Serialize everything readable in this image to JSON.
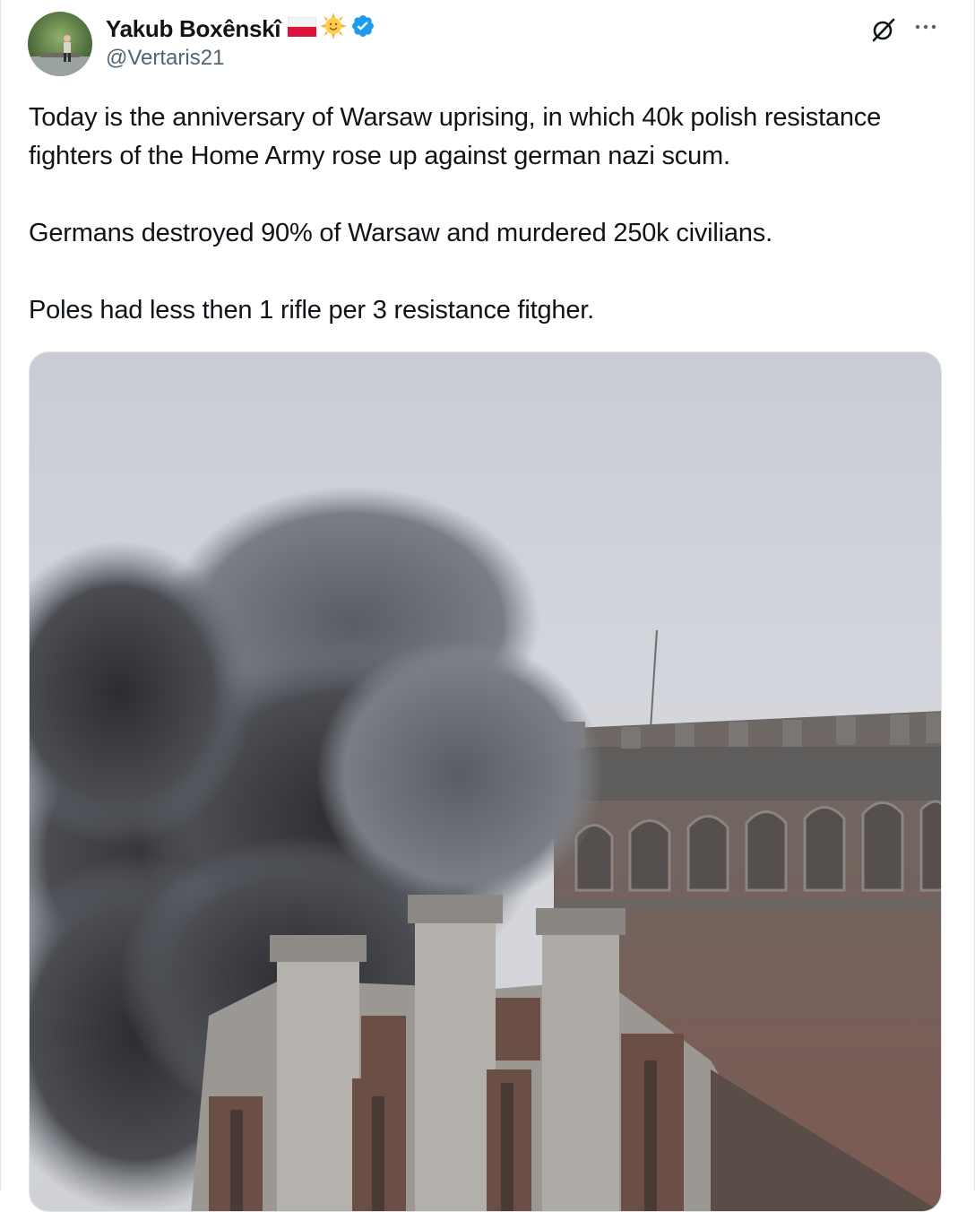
{
  "author": {
    "display_name": "Yakub Boxênskî",
    "handle": "@Vertaris21",
    "badges": [
      "poland-flag-icon",
      "sun-face-icon",
      "verified-badge-icon"
    ]
  },
  "header_actions": [
    "grok-icon",
    "more-icon"
  ],
  "tweet": {
    "paragraphs": [
      "Today is the anniversary of Warsaw uprising, in which 40k polish resistance fighters of the Home Army rose up against german nazi scum.",
      "Germans destroyed 90% of Warsaw and murdered 250k civilians.",
      "Poles had less then 1 rifle per 3 resistance fitgher."
    ]
  },
  "colors": {
    "text": "#0f1419",
    "secondary_text": "#536471",
    "verified": "#1d9bf0"
  }
}
